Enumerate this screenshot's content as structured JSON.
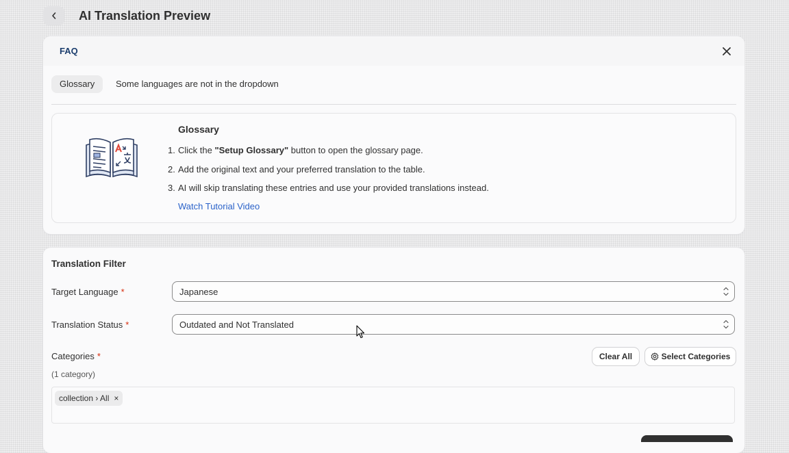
{
  "header": {
    "title": "AI Translation Preview"
  },
  "faq": {
    "title": "FAQ",
    "tabs": [
      {
        "label": "Glossary"
      },
      {
        "label": "Some languages are not in the dropdown"
      }
    ],
    "glossary": {
      "heading": "Glossary",
      "steps": [
        {
          "num": "1.",
          "before": "Click the ",
          "bold": "\"Setup Glossary\"",
          "after": " button to open the glossary page."
        },
        {
          "num": "2.",
          "text": "Add the original text and your preferred translation to the table."
        },
        {
          "num": "3.",
          "text": "AI will skip translating these entries and use your provided translations instead."
        }
      ],
      "link": "Watch Tutorial Video"
    }
  },
  "filter": {
    "title": "Translation Filter",
    "target_language": {
      "label": "Target Language",
      "required": "*",
      "value": "Japanese"
    },
    "translation_status": {
      "label": "Translation Status",
      "required": "*",
      "value": "Outdated and Not Translated"
    },
    "categories": {
      "label": "Categories",
      "required": "*",
      "count": "(1 category)",
      "clear_label": "Clear All",
      "select_label": "Select Categories",
      "tags": [
        {
          "label": "collection › All",
          "remove": "×"
        }
      ]
    }
  },
  "colors": {
    "link": "#2a62c9",
    "required": "#d72c0d",
    "faq_title": "#1b3d6d"
  },
  "icons": [
    "back-chevron-icon",
    "close-icon",
    "chevron-updown-icon",
    "gear-icon",
    "book-translate-illustration",
    "mouse-cursor"
  ]
}
